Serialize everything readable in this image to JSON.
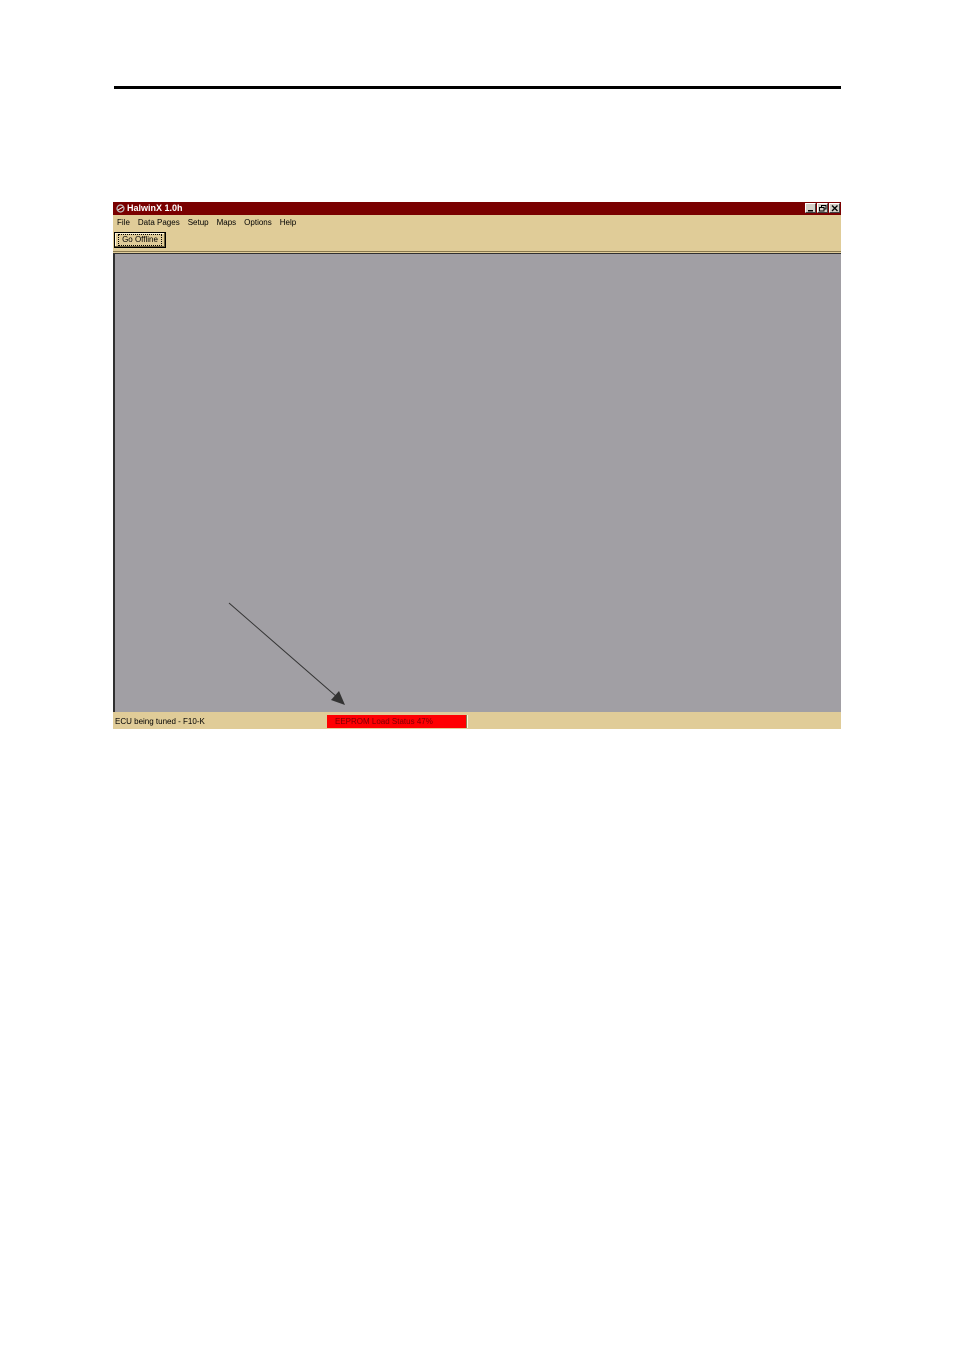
{
  "window": {
    "title": "HalwinX 1.0h"
  },
  "menu": {
    "items": [
      "File",
      "Data Pages",
      "Setup",
      "Maps",
      "Options",
      "Help"
    ]
  },
  "toolbar": {
    "go_offline_label": "Go Offline"
  },
  "status": {
    "ecu_text": "ECU being tuned - F10-K",
    "eeprom_text": "EEPROM Load Status 47%",
    "eeprom_progress_percent": 47
  },
  "colors": {
    "titlebar": "#7a0000",
    "chrome": "#e0cc98",
    "client_area": "#a19fa4",
    "status_alert": "#ff0000"
  }
}
